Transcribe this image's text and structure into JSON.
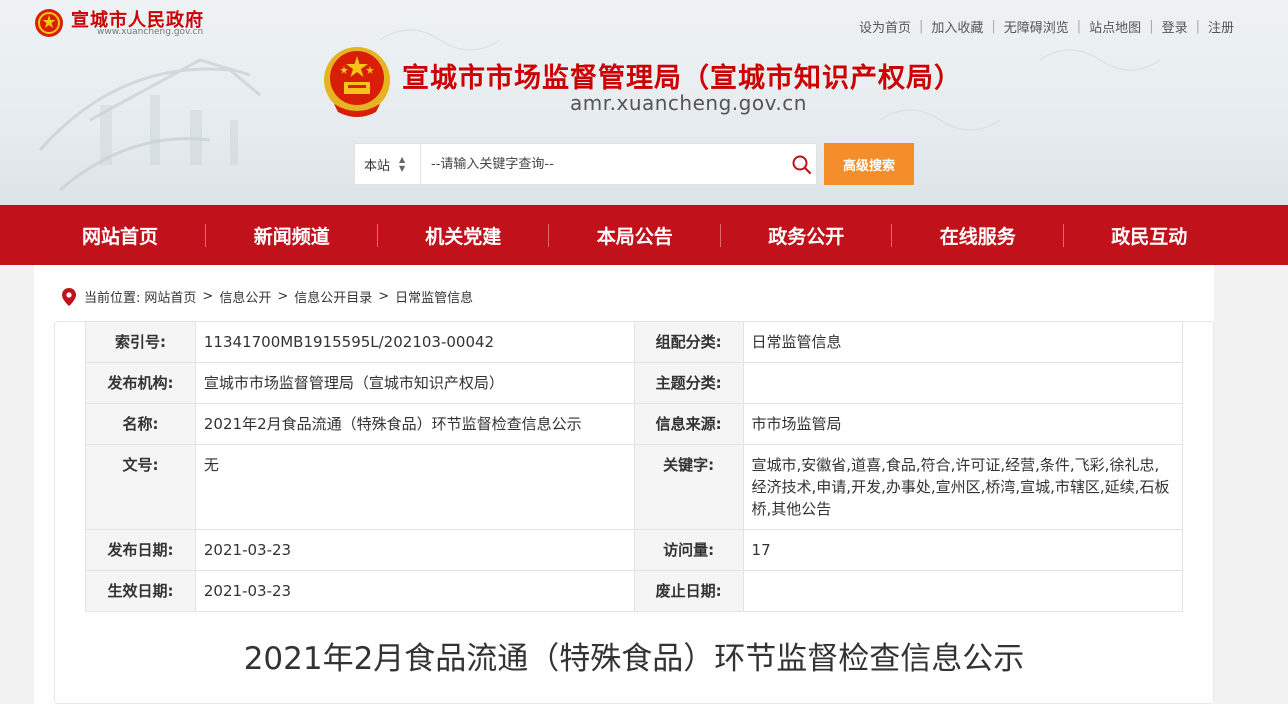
{
  "gov": {
    "name": "宣城市人民政府",
    "url": "www.xuancheng.gov.cn"
  },
  "toplinks": [
    "设为首页",
    "加入收藏",
    "无障碍浏览",
    "站点地图",
    "登录",
    "注册"
  ],
  "site": {
    "title": "宣城市市场监督管理局（宣城市知识产权局）",
    "url": "amr.xuancheng.gov.cn"
  },
  "search": {
    "scope": "本站",
    "placeholder": "--请输入关键字查询--",
    "advanced_label": "高级搜索"
  },
  "nav": [
    "网站首页",
    "新闻频道",
    "机关党建",
    "本局公告",
    "政务公开",
    "在线服务",
    "政民互动"
  ],
  "breadcrumb": {
    "prefix": "当前位置:",
    "items": [
      "网站首页",
      "信息公开",
      "信息公开目录",
      "日常监管信息"
    ]
  },
  "meta": {
    "index_label": "索引号:",
    "index_value": "11341700MB1915595L/202103-00042",
    "category_label": "组配分类:",
    "category_value": "日常监管信息",
    "publisher_label": "发布机构:",
    "publisher_value": "宣城市市场监督管理局（宣城市知识产权局）",
    "topic_label": "主题分类:",
    "topic_value": "",
    "name_label": "名称:",
    "name_value": "2021年2月食品流通（特殊食品）环节监督检查信息公示",
    "source_label": "信息来源:",
    "source_value": "市市场监管局",
    "docno_label": "文号:",
    "docno_value": "无",
    "keywords_label": "关键字:",
    "keywords_value": "宣城市,安徽省,道喜,食品,符合,许可证,经营,条件,飞彩,徐礼忠,经济技术,申请,开发,办事处,宣州区,桥湾,宣城,市辖区,延续,石板桥,其他公告",
    "pubdate_label": "发布日期:",
    "pubdate_value": "2021-03-23",
    "visits_label": "访问量:",
    "visits_value": "17",
    "effective_label": "生效日期:",
    "effective_value": "2021-03-23",
    "repeal_label": "废止日期:",
    "repeal_value": ""
  },
  "article": {
    "title": "2021年2月食品流通（特殊食品）环节监督检查信息公示"
  },
  "colors": {
    "brand_red": "#c1121c",
    "title_red": "#cc0000",
    "search_orange": "#f58d2a"
  }
}
